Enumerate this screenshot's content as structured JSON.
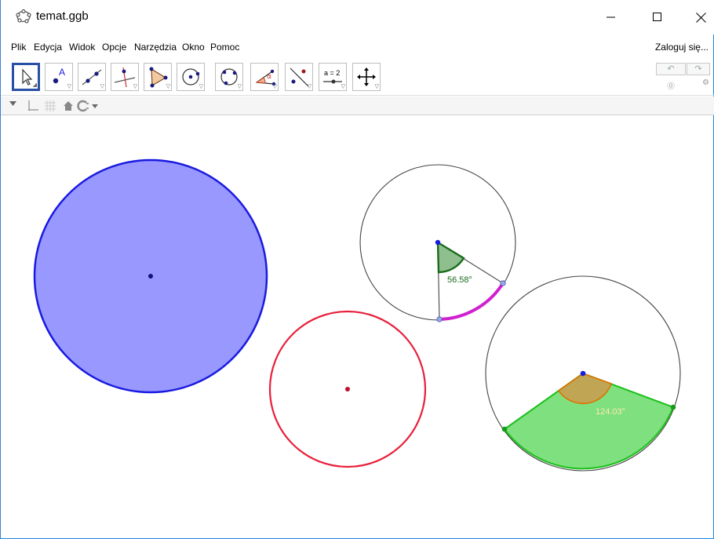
{
  "window": {
    "title": "temat.ggb"
  },
  "menu": {
    "items": [
      "Plik",
      "Edycja",
      "Widok",
      "Opcje",
      "Narzędzia",
      "Okno",
      "Pomoc"
    ],
    "login": "Zaloguj się..."
  },
  "toolbar": {
    "tools": [
      "move-tool",
      "point-tool",
      "line-tool",
      "perpendicular-tool",
      "polygon-tool",
      "circle-center-point-tool",
      "circle-three-points-tool",
      "angle-tool",
      "reflect-tool",
      "slider-tool",
      "move-graphics-view-tool"
    ],
    "slider_label": "a = 2",
    "point_label": "A",
    "angle_symbol": "α"
  },
  "graphics": {
    "angle_1": "56.58°",
    "angle_2": "124.03°",
    "colors": {
      "blue_circle_fill": "#9898ff",
      "blue_circle_stroke": "#1a1ae0",
      "red_circle_stroke": "#e8203c",
      "arc_magenta": "#d020d0",
      "dark_green": "#1a6b1a",
      "sector_green": "#7ee07e",
      "sector_orange": "#e07000"
    }
  }
}
